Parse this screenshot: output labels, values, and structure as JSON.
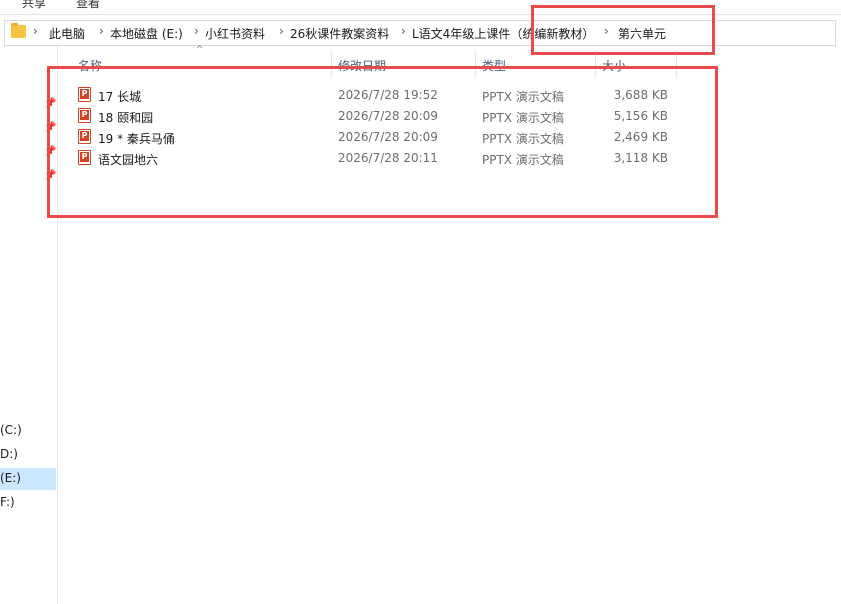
{
  "ribbon": {
    "tabs": [
      "共享",
      "查看"
    ]
  },
  "address_bar": {
    "breadcrumbs": [
      "此电脑",
      "本地磁盘 (E:)",
      "小红书资料",
      "26秋课件教案资料",
      "L语文4年级上课件（统编新教材）",
      "第六单元"
    ],
    "separator": "›"
  },
  "navigation_pane": {
    "drives": [
      "(C:)",
      "D:)",
      "(E:)",
      "F:)"
    ],
    "selected_drive": "(E:)"
  },
  "columns": {
    "name": "名称",
    "date_modified": "修改日期",
    "type": "类型",
    "size": "大小"
  },
  "files": [
    {
      "name": "17 长城",
      "date_modified": "2026/7/28 19:52",
      "type": "PPTX 演示文稿",
      "size": "3,688 KB"
    },
    {
      "name": "18 颐和园",
      "date_modified": "2026/7/28 20:09",
      "type": "PPTX 演示文稿",
      "size": "5,156 KB"
    },
    {
      "name": "19 * 秦兵马俑",
      "date_modified": "2026/7/28 20:09",
      "type": "PPTX 演示文稿",
      "size": "2,469 KB"
    },
    {
      "name": "语文园地六",
      "date_modified": "2026/7/28 20:11",
      "type": "PPTX 演示文稿",
      "size": "3,118 KB"
    }
  ],
  "colors": {
    "highlight_box": "#e84b4b",
    "selected_bg": "#cce8ff",
    "folder": "#f5c542",
    "pptx": "#d04423"
  }
}
